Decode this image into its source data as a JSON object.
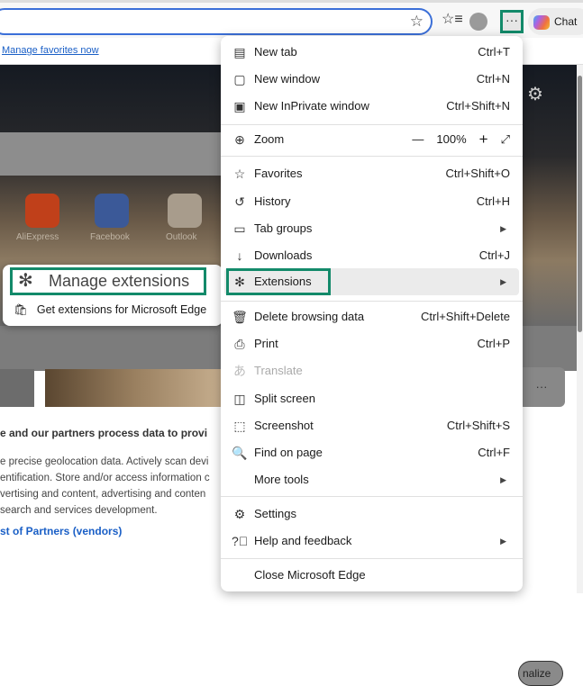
{
  "toolbar": {
    "chat_label": "Chat",
    "more_label": "···"
  },
  "favorites_bar": {
    "link": "Manage favorites now"
  },
  "new_tab_page": {
    "tiles": [
      "AliExpress",
      "Facebook",
      "Outlook"
    ],
    "personalize": "nalize",
    "card_more": "···"
  },
  "consent": {
    "heading": "e and our partners process data to provi",
    "lines": [
      "e precise geolocation data. Actively scan devi",
      "entification. Store and/or access information c",
      "vertising and content, advertising and conten",
      "search and services development."
    ],
    "link": "st of Partners (vendors)"
  },
  "extensions_submenu": {
    "manage": "Manage extensions",
    "get": "Get extensions for Microsoft Edge"
  },
  "menu": {
    "items": [
      {
        "label": "New tab",
        "shortcut": "Ctrl+T"
      },
      {
        "label": "New window",
        "shortcut": "Ctrl+N"
      },
      {
        "label": "New InPrivate window",
        "shortcut": "Ctrl+Shift+N"
      },
      {
        "label": "Zoom",
        "value": "100%"
      },
      {
        "label": "Favorites",
        "shortcut": "Ctrl+Shift+O"
      },
      {
        "label": "History",
        "shortcut": "Ctrl+H"
      },
      {
        "label": "Tab groups"
      },
      {
        "label": "Downloads",
        "shortcut": "Ctrl+J"
      },
      {
        "label": "Extensions"
      },
      {
        "label": "Delete browsing data",
        "shortcut": "Ctrl+Shift+Delete"
      },
      {
        "label": "Print",
        "shortcut": "Ctrl+P"
      },
      {
        "label": "Translate",
        "disabled": true
      },
      {
        "label": "Split screen"
      },
      {
        "label": "Screenshot",
        "shortcut": "Ctrl+Shift+S"
      },
      {
        "label": "Find on page",
        "shortcut": "Ctrl+F"
      },
      {
        "label": "More tools"
      },
      {
        "label": "Settings"
      },
      {
        "label": "Help and feedback"
      },
      {
        "label": "Close Microsoft Edge"
      }
    ]
  },
  "colors": {
    "highlight_border": "#138a6a",
    "link": "#1a5fc6"
  }
}
